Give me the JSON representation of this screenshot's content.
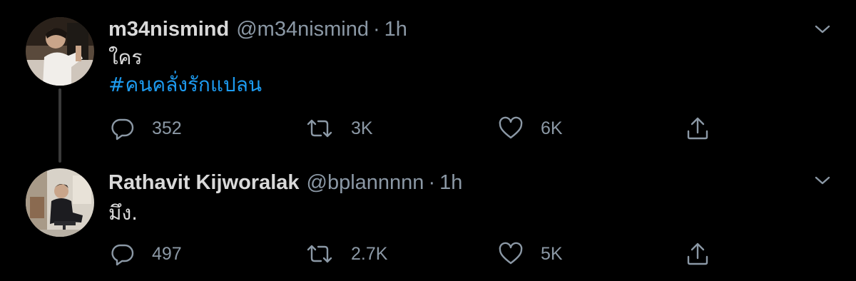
{
  "tweets": [
    {
      "display_name": "m34nismind",
      "handle": "@m34nismind",
      "separator": "·",
      "time": "1h",
      "text": "ใคร",
      "hashtag": "#คนคลั่งรักแปลน",
      "reply_count": "352",
      "retweet_count": "3K",
      "like_count": "6K"
    },
    {
      "display_name": "Rathavit Kijworalak",
      "handle": "@bplannnnn",
      "separator": "·",
      "time": "1h",
      "text": "มึง.",
      "reply_count": "497",
      "retweet_count": "2.7K",
      "like_count": "5K"
    }
  ],
  "icons": {
    "reply": "reply-icon",
    "retweet": "retweet-icon",
    "like": "like-icon",
    "share": "share-icon",
    "caret": "chevron-down-icon"
  },
  "colors": {
    "background": "#000000",
    "text": "#d9d9d9",
    "muted": "#8b98a5",
    "link": "#1d9bf0"
  }
}
